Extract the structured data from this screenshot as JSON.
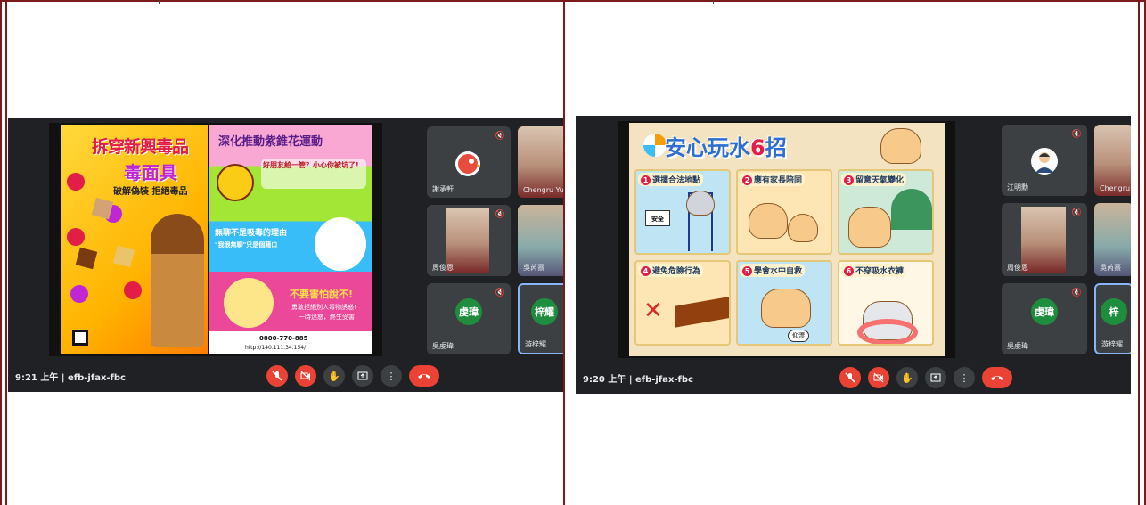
{
  "colors": {
    "frame": "#7a1a1a",
    "meet_bg": "#202124",
    "tile_bg": "#3c4043",
    "danger": "#ea4335",
    "avatar_green": "#1e8e3e",
    "active_blue": "#8ab4f8"
  },
  "left_meeting": {
    "time": "9:21 上午",
    "meeting_code": "efb-jfax-fbc",
    "poster": {
      "title_line1": "拆穿新興毒品",
      "title_line2": "毒面具",
      "subtitle": "破解偽裝 拒絕毒品",
      "right_heading": "深化推動紫錐花運動",
      "bubble_text": "好朋友給一管？小心你被坑了!",
      "band2": "無聊不是吸毒的理由",
      "band2_sub": "\"我很無聊\"只是個藉口",
      "band3": "不要害怕說不!",
      "band3_sub1": "勇敢拒絕別人毒物誘惑!",
      "band3_sub2": "一時迷惑，終生受害",
      "hotline": "0800-770-885",
      "url": "http://140.111.34.154/"
    },
    "participants": [
      {
        "name": "謝承軒",
        "avatar": "bird-avatar",
        "muted": true
      },
      {
        "name": "Chengru Yue",
        "avatar": "camera",
        "muted": false
      },
      {
        "name": "周俊恩",
        "avatar": "camera",
        "muted": true
      },
      {
        "name": "吳芮熹",
        "avatar": "camera",
        "muted": false
      },
      {
        "name": "吳虔瑋",
        "initials": "虔瑋",
        "muted": true
      },
      {
        "name": "游梓耀",
        "initials": "梓耀",
        "muted": false,
        "active": true
      }
    ]
  },
  "right_meeting": {
    "time": "9:20 上午",
    "meeting_code": "efb-jfax-fbc",
    "poster": {
      "title_main": "安心玩水",
      "title_num": "6",
      "title_suffix": "招",
      "tips": [
        {
          "n": "1",
          "text": "選擇合法地點"
        },
        {
          "n": "2",
          "text": "應有家長陪同"
        },
        {
          "n": "3",
          "text": "留意天氣變化"
        },
        {
          "n": "4",
          "text": "避免危險行為"
        },
        {
          "n": "5",
          "text": "學會水中自救"
        },
        {
          "n": "6",
          "text": "不穿吸水衣褲"
        }
      ],
      "sign_text": "安全",
      "float_label": "仰漂"
    },
    "participants": [
      {
        "name": "江明勳",
        "avatar": "person-avatar",
        "muted": true
      },
      {
        "name": "Chengru",
        "avatar": "camera",
        "muted": false
      },
      {
        "name": "周俊恩",
        "avatar": "camera",
        "muted": true
      },
      {
        "name": "吳芮熹",
        "avatar": "camera",
        "muted": false
      },
      {
        "name": "吳虔瑋",
        "initials": "虔瑋",
        "muted": true
      },
      {
        "name": "游梓耀",
        "initials": "梓",
        "muted": false,
        "active": true
      }
    ]
  },
  "controls": [
    "mic-off-icon",
    "camera-off-icon",
    "raise-hand-icon",
    "present-icon",
    "more-icon",
    "end-call-icon"
  ]
}
